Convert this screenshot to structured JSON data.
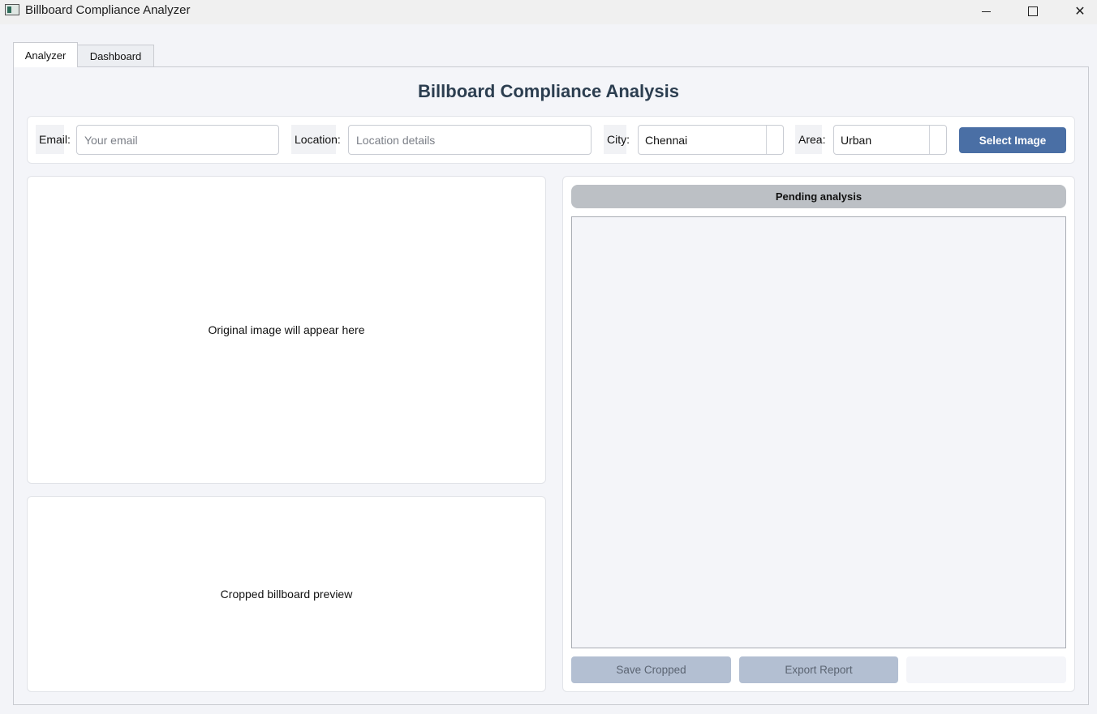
{
  "window": {
    "title": "Billboard Compliance Analyzer",
    "minimize_icon": "minimize-icon",
    "maximize_icon": "maximize-icon",
    "close_icon": "close-icon",
    "close_glyph": "✕"
  },
  "tabs": [
    {
      "label": "Analyzer",
      "active": true
    },
    {
      "label": "Dashboard",
      "active": false
    }
  ],
  "page_title": "Billboard Compliance Analysis",
  "form": {
    "email_label": "Email:",
    "email_placeholder": "Your email",
    "email_value": "",
    "location_label": "Location:",
    "location_placeholder": "Location details",
    "location_value": "",
    "city_label": "City:",
    "city_value": "Chennai",
    "area_label": "Area:",
    "area_value": "Urban",
    "select_image_label": "Select Image"
  },
  "previews": {
    "original_text": "Original image will appear here",
    "cropped_text": "Cropped billboard preview"
  },
  "analysis": {
    "status": "Pending analysis",
    "report_text": ""
  },
  "actions": {
    "save_cropped": "Save Cropped",
    "export_report": "Export Report"
  },
  "colors": {
    "accent": "#4a6fa5",
    "disabled_button": "#b3bfd2",
    "status_pill": "#bcc0c5",
    "title": "#2c3e50"
  }
}
